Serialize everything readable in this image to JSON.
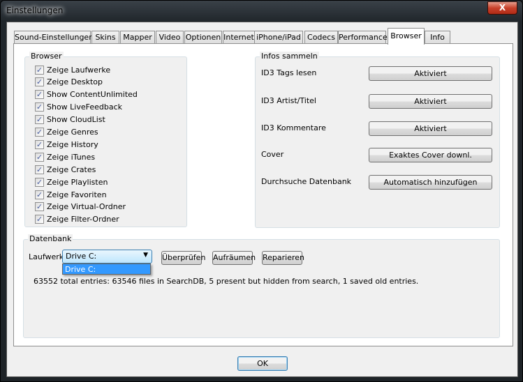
{
  "window": {
    "title": "Einstellungen",
    "close": "X"
  },
  "tabs": [
    "Sound-Einstellungen",
    "Skins",
    "Mapper",
    "Video",
    "Optionen",
    "Internet",
    "iPhone/iPad",
    "Codecs",
    "Performance",
    "Browser",
    "Info"
  ],
  "browser": {
    "title": "Browser",
    "items": [
      "Zeige Laufwerke",
      "Zeige Desktop",
      "Show ContentUnlimited",
      "Show LiveFeedback",
      "Show CloudList",
      "Zeige Genres",
      "Zeige History",
      "Zeige iTunes",
      "Zeige Crates",
      "Zeige Playlisten",
      "Zeige Favoriten",
      "Zeige Virtual-Ordner",
      "Zeige Filter-Ordner"
    ]
  },
  "infos": {
    "title": "Infos sammeln",
    "rows": [
      {
        "label": "ID3 Tags lesen",
        "value": "Aktiviert"
      },
      {
        "label": "ID3 Artist/Titel",
        "value": "Aktiviert"
      },
      {
        "label": "ID3 Kommentare",
        "value": "Aktiviert"
      },
      {
        "label": "Cover",
        "value": "Exaktes Cover downl."
      },
      {
        "label": "Durchsuche Datenbank",
        "value": "Automatisch hinzufügen"
      }
    ]
  },
  "db": {
    "title": "Datenbank",
    "drive_label": "Laufwerk",
    "drive_value": "Drive C:",
    "drive_option": "Drive C:",
    "check": "Überprüfen",
    "clean": "Aufräumen",
    "repair": "Reparieren",
    "status": "63552 total entries: 63546 files in SearchDB, 5 present but hidden from search, 1 saved old entries."
  },
  "ok": "OK"
}
